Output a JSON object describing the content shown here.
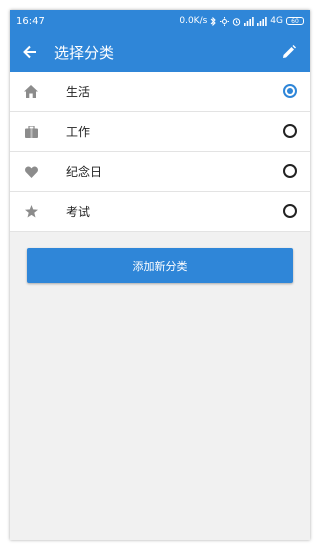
{
  "status": {
    "time": "16:47",
    "speed": "0.0K/s",
    "network": "4G",
    "battery": "60"
  },
  "appbar": {
    "title": "选择分类",
    "back_icon": "arrow-back-icon",
    "edit_icon": "pencil-icon"
  },
  "categories": [
    {
      "label": "生活",
      "icon": "home-icon",
      "selected": true
    },
    {
      "label": "工作",
      "icon": "briefcase-icon",
      "selected": false
    },
    {
      "label": "纪念日",
      "icon": "heart-icon",
      "selected": false
    },
    {
      "label": "考试",
      "icon": "star-icon",
      "selected": false
    }
  ],
  "add_button": {
    "label": "添加新分类"
  },
  "colors": {
    "primary": "#2f86d8",
    "icon_gray": "#8c8c8c"
  }
}
